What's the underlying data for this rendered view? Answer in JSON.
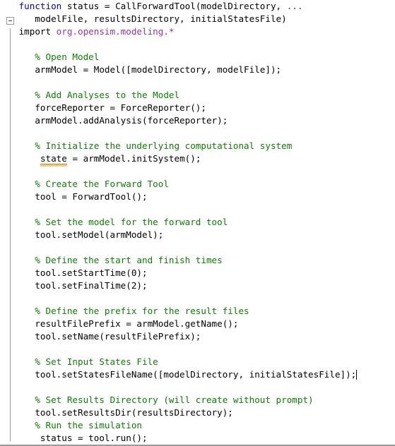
{
  "editor": {
    "app": "matlab-editor",
    "language": "MATLAB",
    "background_color": "#ffffff",
    "colors": {
      "keyword": "#0000cc",
      "comment": "#0b8000",
      "package": "#9b30b0",
      "continuation": "#2b2bbb",
      "text": "#000000",
      "warning_underline": "#d98b00",
      "gutter_line": "#a0a0a0"
    }
  },
  "gutter": {
    "fold_marker_label": "-",
    "fold_marker_state": "expanded"
  },
  "code": {
    "lines": [
      {
        "indent": 1,
        "tokens": [
          {
            "t": "function",
            "c": "kw"
          },
          {
            "t": " status = CallForwardTool(modelDirectory, ",
            "c": "plain"
          },
          {
            "t": "...",
            "c": "cont"
          }
        ]
      },
      {
        "indent": 4,
        "tokens": [
          {
            "t": "modelFile, resultsDirectory, initialStatesFile)",
            "c": "plain"
          }
        ]
      },
      {
        "indent": 1,
        "tokens": [
          {
            "t": "import ",
            "c": "plain"
          },
          {
            "t": "org.opensim.modeling.*",
            "c": "pkg"
          }
        ]
      },
      {
        "indent": 0,
        "tokens": []
      },
      {
        "indent": 4,
        "tokens": [
          {
            "t": "% Open Model",
            "c": "cmt"
          }
        ]
      },
      {
        "indent": 4,
        "tokens": [
          {
            "t": "armModel = Model([modelDirectory, modelFile]);",
            "c": "plain"
          }
        ]
      },
      {
        "indent": 0,
        "tokens": []
      },
      {
        "indent": 4,
        "tokens": [
          {
            "t": "% Add Analyses to the Model",
            "c": "cmt"
          }
        ]
      },
      {
        "indent": 4,
        "tokens": [
          {
            "t": "forceReporter = ForceReporter();",
            "c": "plain"
          }
        ]
      },
      {
        "indent": 4,
        "tokens": [
          {
            "t": "armModel.addAnalysis(forceReporter);",
            "c": "plain"
          }
        ]
      },
      {
        "indent": 0,
        "tokens": []
      },
      {
        "indent": 4,
        "tokens": [
          {
            "t": "% Initialize the underlying computational system",
            "c": "cmt"
          }
        ]
      },
      {
        "indent": 4,
        "tokens": [
          {
            "t": " ",
            "c": "plain"
          },
          {
            "t": "state",
            "c": "warn"
          },
          {
            "t": " = armModel.initSystem();",
            "c": "plain"
          }
        ]
      },
      {
        "indent": 0,
        "tokens": []
      },
      {
        "indent": 4,
        "tokens": [
          {
            "t": "% Create the Forward Tool",
            "c": "cmt"
          }
        ]
      },
      {
        "indent": 4,
        "tokens": [
          {
            "t": "tool = ForwardTool();",
            "c": "plain"
          }
        ]
      },
      {
        "indent": 0,
        "tokens": []
      },
      {
        "indent": 4,
        "tokens": [
          {
            "t": "% Set the model for the forward tool",
            "c": "cmt"
          }
        ]
      },
      {
        "indent": 4,
        "tokens": [
          {
            "t": "tool.setModel(armModel);",
            "c": "plain"
          }
        ]
      },
      {
        "indent": 0,
        "tokens": []
      },
      {
        "indent": 4,
        "tokens": [
          {
            "t": "% Define the start and finish times",
            "c": "cmt"
          }
        ]
      },
      {
        "indent": 4,
        "tokens": [
          {
            "t": "tool.setStartTime(0);",
            "c": "plain"
          }
        ]
      },
      {
        "indent": 4,
        "tokens": [
          {
            "t": "tool.setFinalTime(2);",
            "c": "plain"
          }
        ]
      },
      {
        "indent": 0,
        "tokens": []
      },
      {
        "indent": 4,
        "tokens": [
          {
            "t": "% Define the prefix for the result files",
            "c": "cmt"
          }
        ]
      },
      {
        "indent": 4,
        "tokens": [
          {
            "t": "resultFilePrefix = armModel.getName();",
            "c": "plain"
          }
        ]
      },
      {
        "indent": 4,
        "tokens": [
          {
            "t": "tool.setName(resultFilePrefix);",
            "c": "plain"
          }
        ]
      },
      {
        "indent": 0,
        "tokens": []
      },
      {
        "indent": 4,
        "tokens": [
          {
            "t": "% Set Input States File",
            "c": "cmt"
          }
        ]
      },
      {
        "indent": 4,
        "tokens": [
          {
            "t": "tool.setStatesFileName([modelDirectory, initialStatesFile]);",
            "c": "plain"
          }
        ],
        "caret_at_end": true
      },
      {
        "indent": 0,
        "tokens": []
      },
      {
        "indent": 4,
        "tokens": [
          {
            "t": "% Set Results Directory (will create without prompt)",
            "c": "cmt"
          }
        ]
      },
      {
        "indent": 4,
        "tokens": [
          {
            "t": "tool.setResultsDir(resultsDirectory);",
            "c": "plain"
          }
        ]
      },
      {
        "indent": 4,
        "tokens": [
          {
            "t": "% Run the simulation",
            "c": "cmt"
          }
        ]
      },
      {
        "indent": 4,
        "tokens": [
          {
            "t": " status = tool.run();",
            "c": "plain"
          }
        ]
      }
    ]
  }
}
